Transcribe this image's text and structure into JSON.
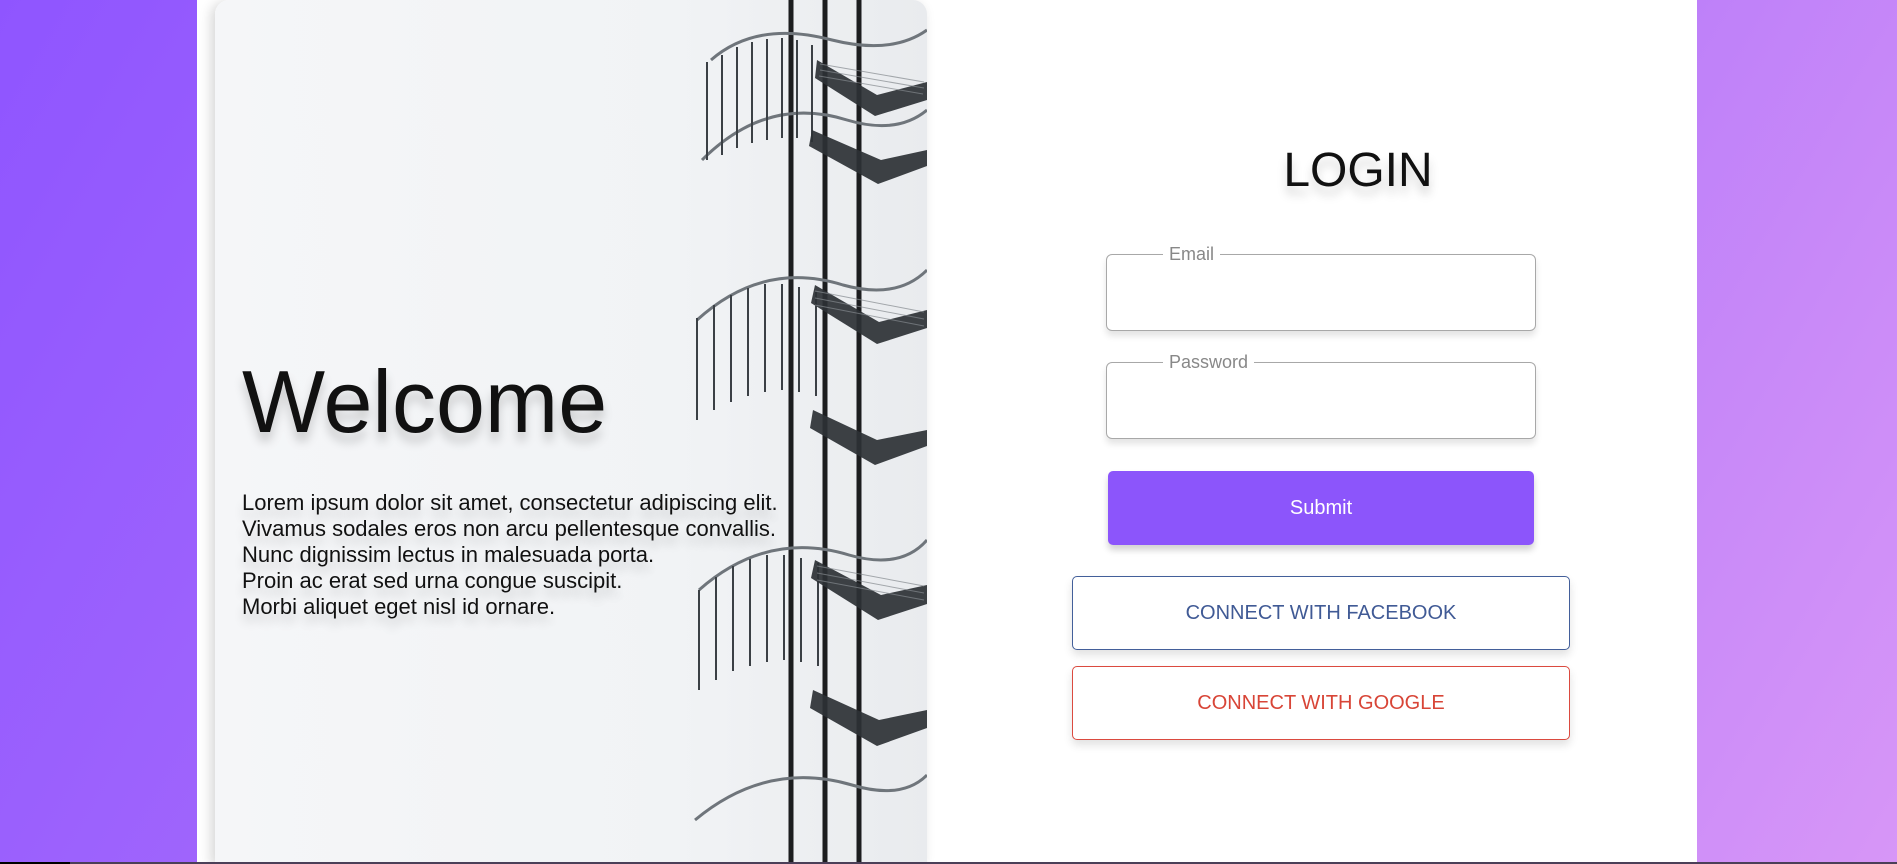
{
  "colors": {
    "accent": "#8c55fb",
    "background_start": "#8f55ff",
    "background_end": "#d796f7",
    "facebook": "#405a95",
    "google": "#d84537"
  },
  "hero": {
    "title": "Welcome",
    "paragraph_lines": [
      "Lorem ipsum dolor sit amet, consectetur adipiscing elit.",
      "Vivamus sodales eros non arcu pellentesque convallis.",
      "Nunc dignissim lectus in malesuada porta.",
      "Proin ac erat sed urna congue suscipit.",
      "Morbi aliquet eget nisl id ornare."
    ],
    "image_icon": "spiral-staircase-image"
  },
  "login": {
    "title": "LOGIN",
    "email_label": "Email",
    "password_label": "Password",
    "email_value": "",
    "password_value": "",
    "submit_label": "Submit",
    "facebook_label": "CONNECT WITH FACEBOOK",
    "google_label": "CONNECT WITH GOOGLE"
  }
}
